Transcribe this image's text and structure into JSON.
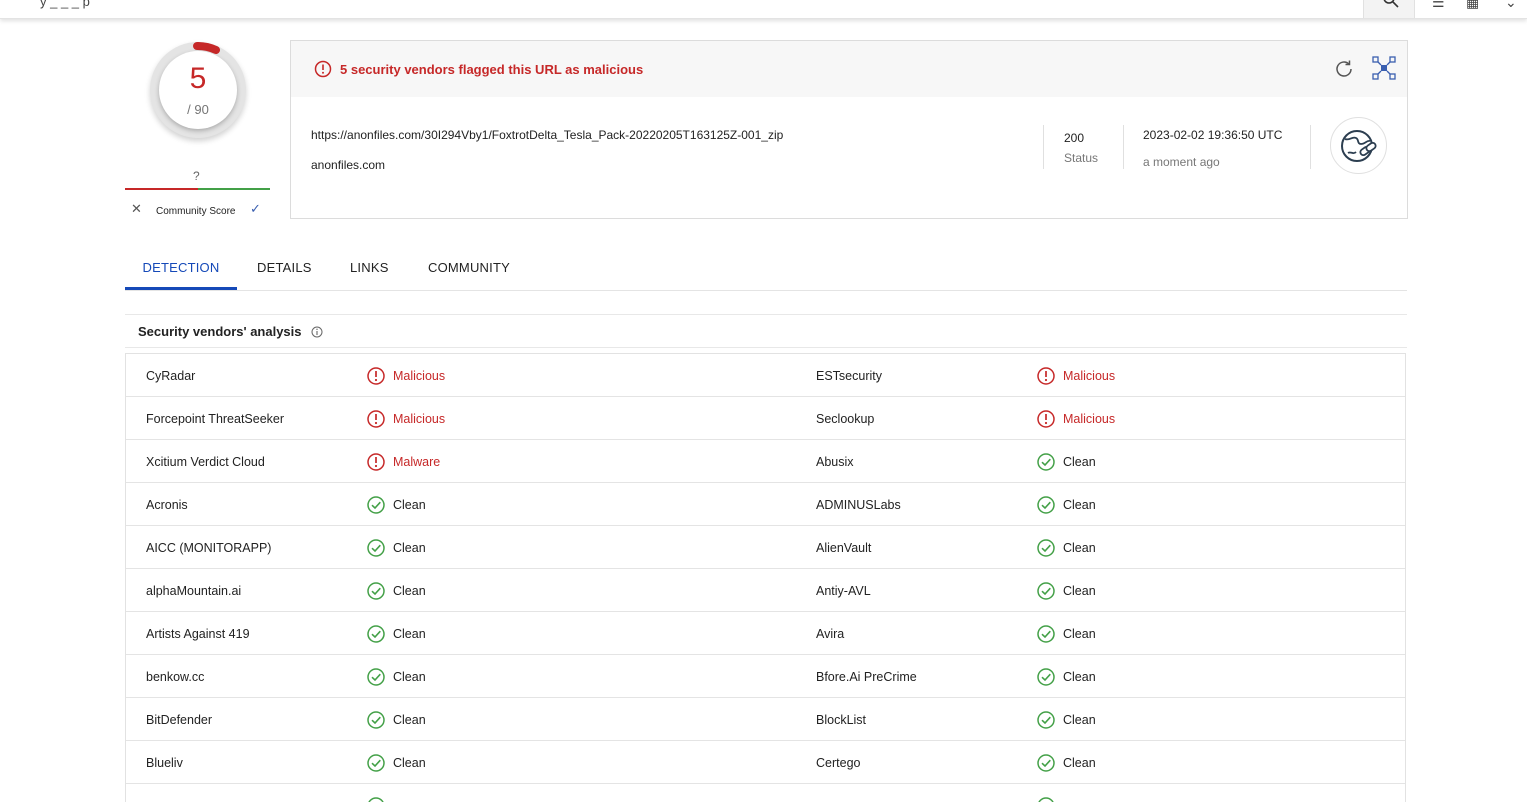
{
  "colors": {
    "malicious": "#c62828",
    "clean": "#43a047",
    "accent": "#1549b8"
  },
  "topbar": {
    "query_text": "y _ _ _ p"
  },
  "score": {
    "detections": "5",
    "total": "/ 90"
  },
  "community": {
    "question": "?",
    "label": "Community Score"
  },
  "alert": {
    "icon": "alert-circle-icon",
    "text": "5 security vendors flagged this URL as malicious"
  },
  "url": {
    "full": "https://anonfiles.com/30I294Vby1/FoxtrotDelta_Tesla_Pack-20220205T163125Z-001_zip",
    "domain": "anonfiles.com",
    "status_code": "200",
    "status_label": "Status",
    "date": "2023-02-02 19:36:50 UTC",
    "relative": "a moment ago"
  },
  "tabs": [
    {
      "label": "DETECTION",
      "active": true
    },
    {
      "label": "DETAILS",
      "active": false
    },
    {
      "label": "LINKS",
      "active": false
    },
    {
      "label": "COMMUNITY",
      "active": false
    }
  ],
  "section": {
    "title": "Security vendors' analysis"
  },
  "vendors": [
    {
      "left": {
        "name": "CyRadar",
        "result": "Malicious",
        "state": "malicious"
      },
      "right": {
        "name": "ESTsecurity",
        "result": "Malicious",
        "state": "malicious"
      }
    },
    {
      "left": {
        "name": "Forcepoint ThreatSeeker",
        "result": "Malicious",
        "state": "malicious"
      },
      "right": {
        "name": "Seclookup",
        "result": "Malicious",
        "state": "malicious"
      }
    },
    {
      "left": {
        "name": "Xcitium Verdict Cloud",
        "result": "Malware",
        "state": "malicious"
      },
      "right": {
        "name": "Abusix",
        "result": "Clean",
        "state": "clean"
      }
    },
    {
      "left": {
        "name": "Acronis",
        "result": "Clean",
        "state": "clean"
      },
      "right": {
        "name": "ADMINUSLabs",
        "result": "Clean",
        "state": "clean"
      }
    },
    {
      "left": {
        "name": "AICC (MONITORAPP)",
        "result": "Clean",
        "state": "clean"
      },
      "right": {
        "name": "AlienVault",
        "result": "Clean",
        "state": "clean"
      }
    },
    {
      "left": {
        "name": "alphaMountain.ai",
        "result": "Clean",
        "state": "clean"
      },
      "right": {
        "name": "Antiy-AVL",
        "result": "Clean",
        "state": "clean"
      }
    },
    {
      "left": {
        "name": "Artists Against 419",
        "result": "Clean",
        "state": "clean"
      },
      "right": {
        "name": "Avira",
        "result": "Clean",
        "state": "clean"
      }
    },
    {
      "left": {
        "name": "benkow.cc",
        "result": "Clean",
        "state": "clean"
      },
      "right": {
        "name": "Bfore.Ai PreCrime",
        "result": "Clean",
        "state": "clean"
      }
    },
    {
      "left": {
        "name": "BitDefender",
        "result": "Clean",
        "state": "clean"
      },
      "right": {
        "name": "BlockList",
        "result": "Clean",
        "state": "clean"
      }
    },
    {
      "left": {
        "name": "Blueliv",
        "result": "Clean",
        "state": "clean"
      },
      "right": {
        "name": "Certego",
        "result": "Clean",
        "state": "clean"
      }
    },
    {
      "left": {
        "name": "",
        "result": "",
        "state": "clean"
      },
      "right": {
        "name": "",
        "result": "",
        "state": "clean"
      }
    }
  ]
}
